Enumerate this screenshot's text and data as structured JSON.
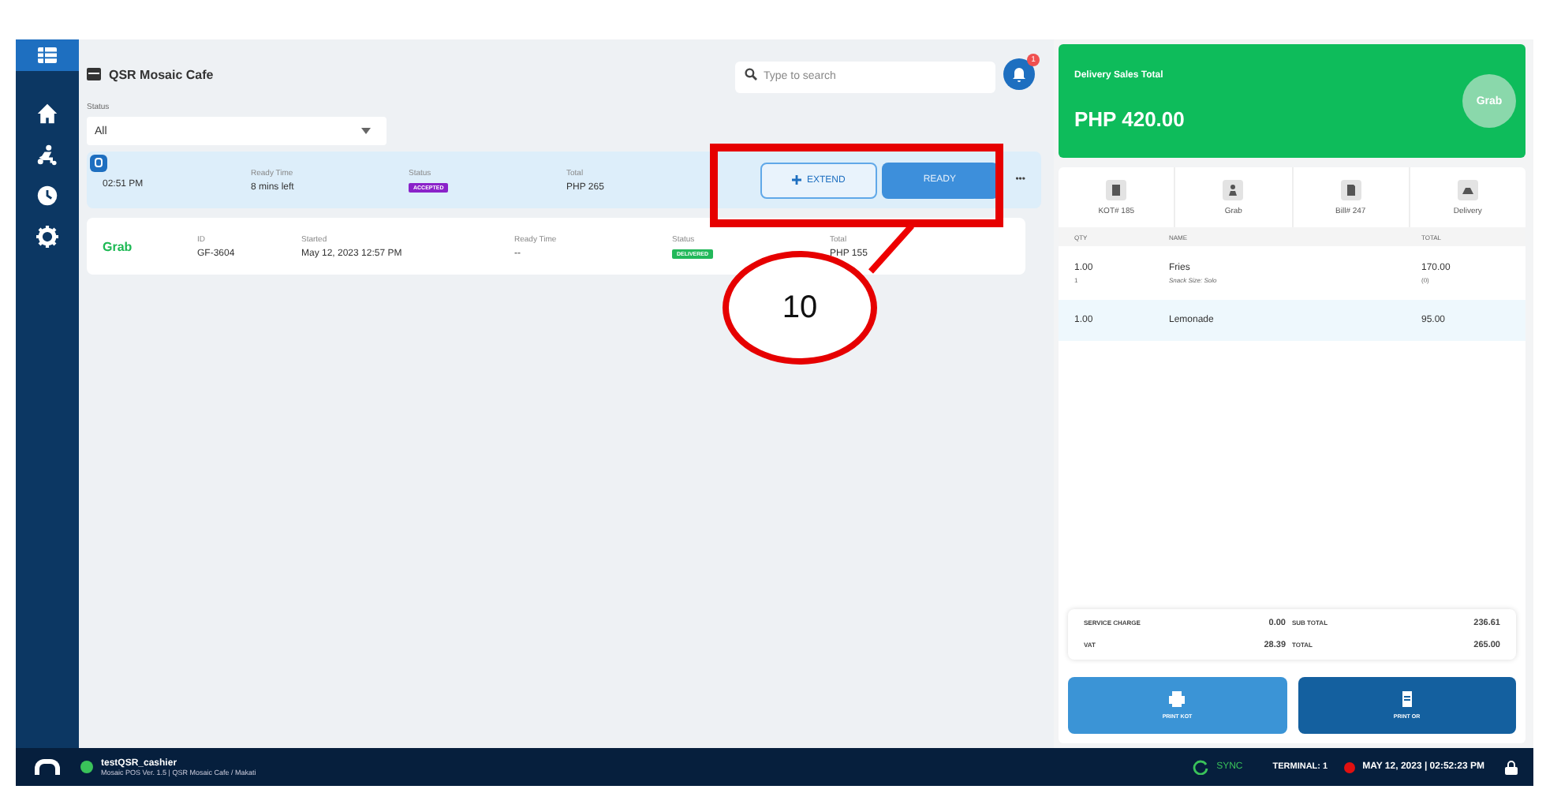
{
  "store": {
    "name": "QSR Mosaic Cafe"
  },
  "search": {
    "placeholder": "Type to search"
  },
  "notifications": {
    "count": "1"
  },
  "filter": {
    "label": "Status",
    "value": "All"
  },
  "orders": [
    {
      "kind": "active",
      "selected": true,
      "time": "02:51 PM",
      "fields": [
        {
          "label": "Ready Time",
          "value": "8 mins left"
        },
        {
          "label": "Status",
          "badge": "ACCEPTED",
          "color": "#8a22c9"
        },
        {
          "label": "Total",
          "value": "PHP 265"
        }
      ],
      "actions": [
        "EXTEND",
        "READY"
      ],
      "more": "•••"
    },
    {
      "kind": "grab",
      "selected": false,
      "logo": "Grab",
      "fields": [
        {
          "label": "ID",
          "value": "GF-3604"
        },
        {
          "label": "Started",
          "value": "May 12, 2023 12:57 PM"
        },
        {
          "label": "Ready Time",
          "value": "--"
        },
        {
          "label": "Status",
          "badge": "DELIVERED",
          "color": "#22b85a"
        },
        {
          "label": "Total",
          "value": "PHP 155"
        }
      ]
    }
  ],
  "sales": {
    "title": "Delivery Sales Total",
    "amount": "PHP 420.00",
    "logo": "Grab"
  },
  "info": [
    {
      "kind": "kot",
      "label": "KOT# 185"
    },
    {
      "kind": "person",
      "label": "Grab"
    },
    {
      "kind": "bill",
      "label": "Bill# 247"
    },
    {
      "kind": "delivery",
      "label": "Delivery"
    }
  ],
  "items_table": {
    "columns": [
      "QTY",
      "NAME",
      "TOTAL"
    ],
    "rows": [
      {
        "selected": false,
        "qty": "1.00",
        "qty_sub": "1",
        "name": "Fries",
        "name_sub": "Snack Size: Solo",
        "total": "170.00",
        "total_sub": "(0)"
      },
      {
        "selected": true,
        "qty": "1.00",
        "name": "Lemonade",
        "total": "95.00"
      }
    ]
  },
  "summary": [
    {
      "label": "SERVICE CHARGE",
      "value": "0.00"
    },
    {
      "label": "SUB TOTAL",
      "value": "236.61"
    },
    {
      "label": "VAT",
      "value": "28.39"
    },
    {
      "label": "TOTAL",
      "value": "265.00"
    }
  ],
  "print_buttons": [
    {
      "kind": "printer",
      "label": "PRINT KOT"
    },
    {
      "kind": "receipt",
      "label": "PRINT OR"
    }
  ],
  "status_bar": {
    "user": "testQSR_cashier",
    "version": "Mosaic POS Ver. 1.5 | QSR Mosaic Cafe / Makati",
    "online": true,
    "sync": "SYNC",
    "terminal": "TERMINAL: 1",
    "datetime": "MAY 12, 2023 | 02:52:23 PM"
  },
  "callout": {
    "label": "10"
  }
}
